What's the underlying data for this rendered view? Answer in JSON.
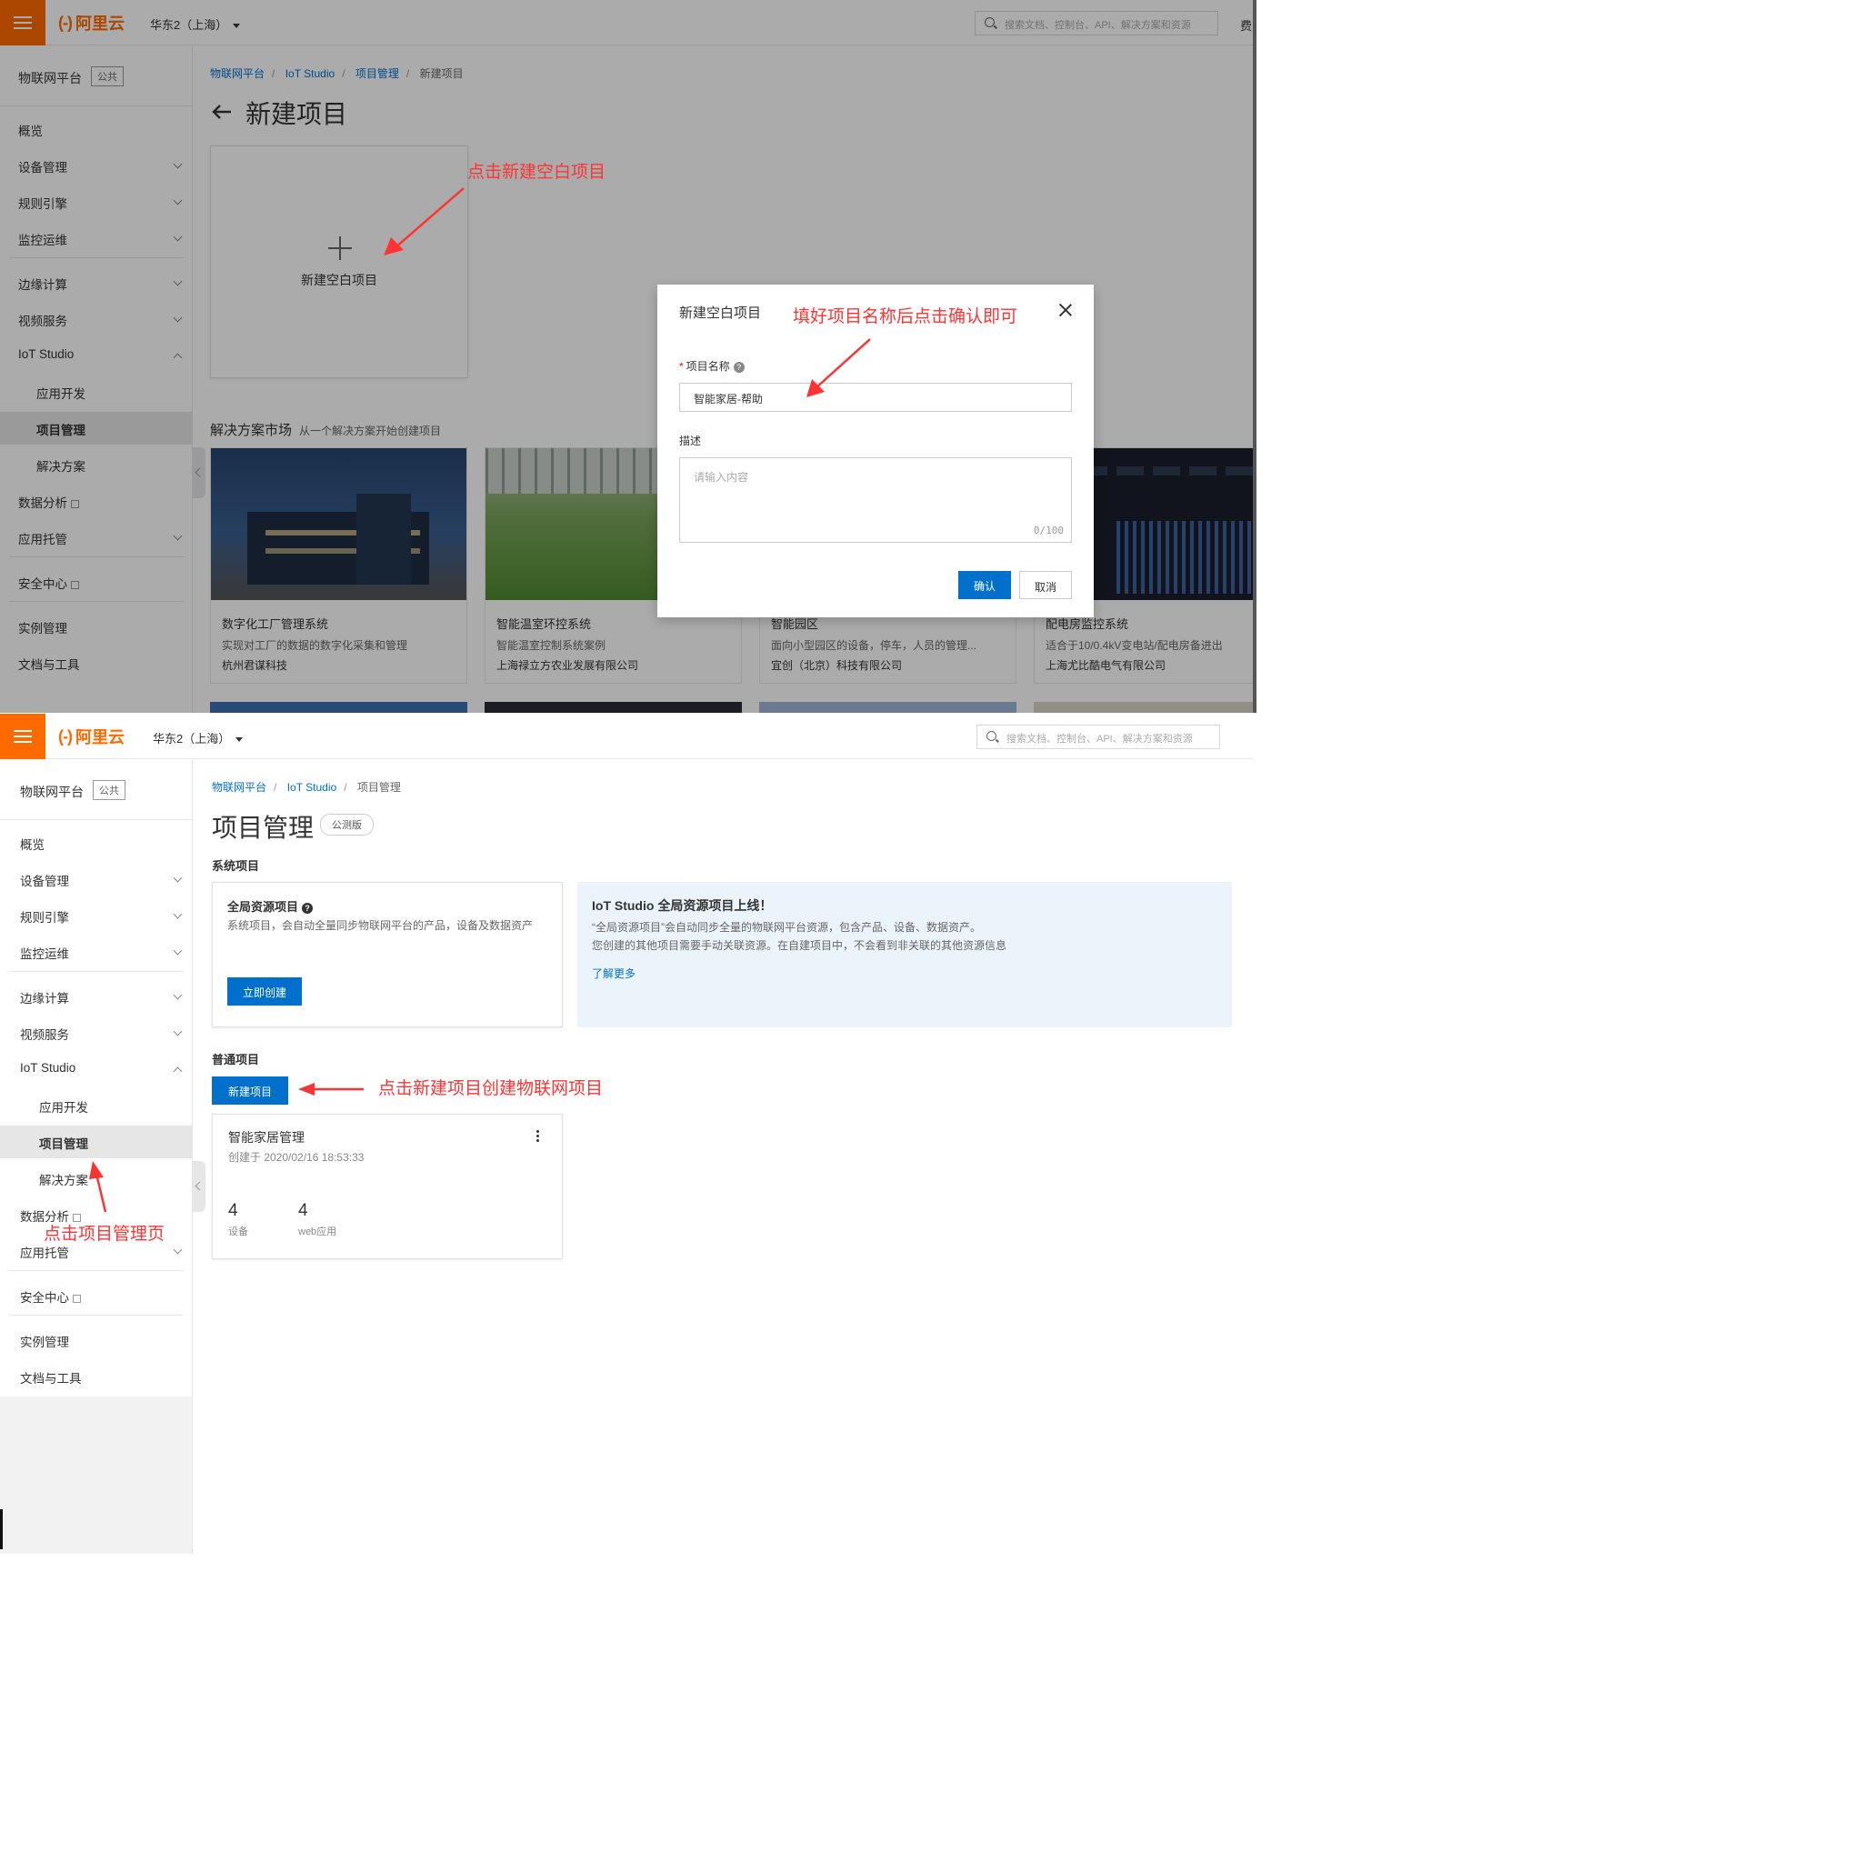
{
  "header": {
    "logo_mark": "(-)",
    "logo_text": "阿里云",
    "region": "华东2（上海）",
    "search_placeholder": "搜索文档、控制台、API、解决方案和资源",
    "edge_text": "费"
  },
  "sidebar": {
    "title": "物联网平台",
    "tag": "公共",
    "items": [
      {
        "label": "概览"
      },
      {
        "label": "设备管理"
      },
      {
        "label": "规则引擎"
      },
      {
        "label": "监控运维"
      },
      {
        "label": "边缘计算"
      },
      {
        "label": "视频服务"
      },
      {
        "label": "IoT Studio"
      },
      {
        "label": "应用开发"
      },
      {
        "label": "项目管理"
      },
      {
        "label": "解决方案"
      },
      {
        "label": "数据分析"
      },
      {
        "label": "应用托管"
      },
      {
        "label": "安全中心"
      },
      {
        "label": "实例管理"
      },
      {
        "label": "文档与工具"
      }
    ]
  },
  "new_project_page": {
    "breadcrumb": [
      "物联网平台",
      "IoT Studio",
      "项目管理",
      "新建项目"
    ],
    "title": "新建项目",
    "blank_card_label": "新建空白项目",
    "market_title": "解决方案市场",
    "market_subtitle": "从一个解决方案开始创建项目",
    "solutions": [
      {
        "name": "数字化工厂管理系统",
        "desc": "实现对工厂的数据的数字化采集和管理",
        "company": "杭州君谋科技"
      },
      {
        "name": "智能温室环控系统",
        "desc": "智能温室控制系统案例",
        "company": "上海禄立方农业发展有限公司"
      },
      {
        "name": "智能园区",
        "desc": "面向小型园区的设备，停车，人员的管理...",
        "company": "宜创（北京）科技有限公司"
      },
      {
        "name": "配电房监控系统",
        "desc": "适合于10/0.4kV变电站/配电房备进出",
        "company": "上海尤比酷电气有限公司"
      }
    ],
    "modal": {
      "title": "新建空白项目",
      "name_label": "项目名称",
      "name_value": "智能家居-帮助",
      "desc_label": "描述",
      "desc_placeholder": "请输入内容",
      "counter": "0/100",
      "confirm": "确认",
      "cancel": "取消"
    },
    "annotations": {
      "click_new_blank": "点击新建空白项目",
      "fill_name_confirm": "填好项目名称后点击确认即可"
    }
  },
  "project_page": {
    "breadcrumb": [
      "物联网平台",
      "IoT Studio",
      "项目管理"
    ],
    "title": "项目管理",
    "tag": "公测版",
    "system_section": "系统项目",
    "system_card": {
      "title": "全局资源项目",
      "desc": "系统项目，会自动全量同步物联网平台的产品，设备及数据资产",
      "button": "立即创建"
    },
    "info_box": {
      "title": "IoT Studio 全局资源项目上线！",
      "line1": "“全局资源项目”会自动同步全量的物联网平台资源，包含产品、设备、数据资产。",
      "line2": "您创建的其他项目需要手动关联资源。在自建项目中，不会看到非关联的其他资源信息",
      "more": "了解更多"
    },
    "normal_section": "普通项目",
    "new_button": "新建项目",
    "project_card": {
      "name": "智能家居管理",
      "created": "创建于 2020/02/16 18:53:33",
      "devices_count": "4",
      "devices_label": "设备",
      "apps_count": "4",
      "apps_label": "web应用"
    },
    "annotations": {
      "click_new_project": "点击新建项目创建物联网项目",
      "click_project_mgmt": "点击项目管理页"
    }
  },
  "colors": {
    "brand_orange": "#ff6a00",
    "primary_blue": "#0070cc",
    "annotation_red": "#ff3333"
  }
}
